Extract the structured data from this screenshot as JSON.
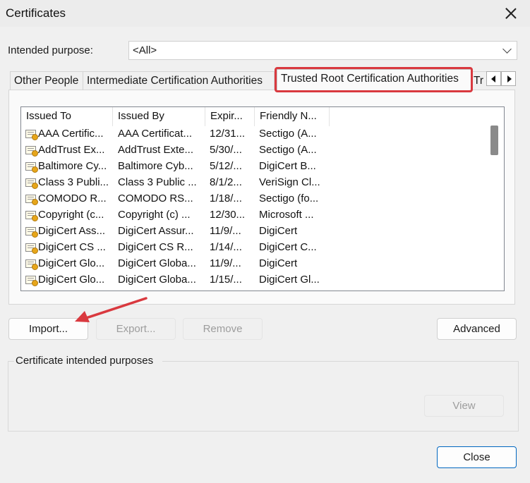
{
  "window": {
    "title": "Certificates"
  },
  "purpose": {
    "label": "Intended purpose:",
    "value": "<All>"
  },
  "tabs": [
    {
      "label": "Other People"
    },
    {
      "label": "Intermediate Certification Authorities"
    },
    {
      "label": "Trusted Root Certification Authorities"
    },
    {
      "label": "Tr"
    }
  ],
  "columns": [
    "Issued To",
    "Issued By",
    "Expir...",
    "Friendly N..."
  ],
  "rows": [
    {
      "issued_to": "AAA Certific...",
      "issued_by": "AAA Certificat...",
      "expiration": "12/31...",
      "friendly": "Sectigo (A..."
    },
    {
      "issued_to": "AddTrust Ex...",
      "issued_by": "AddTrust Exte...",
      "expiration": "5/30/...",
      "friendly": "Sectigo (A..."
    },
    {
      "issued_to": "Baltimore Cy...",
      "issued_by": "Baltimore Cyb...",
      "expiration": "5/12/...",
      "friendly": "DigiCert B..."
    },
    {
      "issued_to": "Class 3 Publi...",
      "issued_by": "Class 3 Public ...",
      "expiration": "8/1/2...",
      "friendly": "VeriSign Cl..."
    },
    {
      "issued_to": "COMODO R...",
      "issued_by": "COMODO RS...",
      "expiration": "1/18/...",
      "friendly": "Sectigo (fo..."
    },
    {
      "issued_to": "Copyright (c...",
      "issued_by": "Copyright (c) ...",
      "expiration": "12/30...",
      "friendly": "Microsoft ..."
    },
    {
      "issued_to": "DigiCert Ass...",
      "issued_by": "DigiCert Assur...",
      "expiration": "11/9/...",
      "friendly": "DigiCert"
    },
    {
      "issued_to": "DigiCert CS ...",
      "issued_by": "DigiCert CS R...",
      "expiration": "1/14/...",
      "friendly": "DigiCert C..."
    },
    {
      "issued_to": "DigiCert Glo...",
      "issued_by": "DigiCert Globa...",
      "expiration": "11/9/...",
      "friendly": "DigiCert"
    },
    {
      "issued_to": "DigiCert Glo...",
      "issued_by": "DigiCert Globa...",
      "expiration": "1/15/...",
      "friendly": "DigiCert Gl..."
    }
  ],
  "buttons": {
    "import": "Import...",
    "export": "Export...",
    "remove": "Remove",
    "advanced": "Advanced",
    "view": "View",
    "close": "Close"
  },
  "group": {
    "label": "Certificate intended purposes"
  },
  "colors": {
    "highlight": "#d9393f",
    "arrow": "#d9393f",
    "primary_border": "#0067c0"
  }
}
